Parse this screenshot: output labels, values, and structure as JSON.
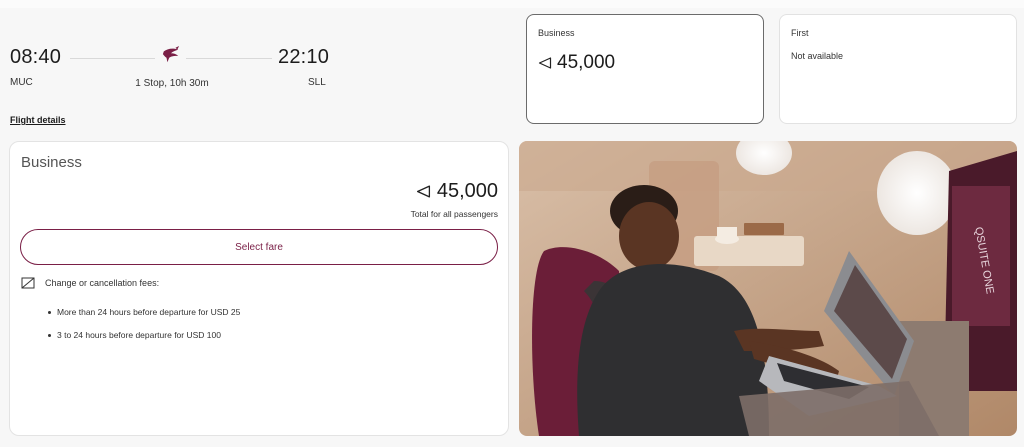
{
  "flight": {
    "depart_time": "08:40",
    "depart_code": "MUC",
    "arrive_time": "22:10",
    "arrive_code": "SLL",
    "stops": "1 Stop, 10h 30m",
    "details_link": "Flight details"
  },
  "cabins": [
    {
      "name": "Business",
      "price": "45,000",
      "selected": true
    },
    {
      "name": "First",
      "status": "Not available"
    }
  ],
  "fare": {
    "title": "Business",
    "price": "45,000",
    "note": "Total for all passengers",
    "select_label": "Select fare",
    "fees_label": "Change or cancellation fees:",
    "fees": [
      "More than 24 hours before departure for USD 25",
      "3 to 24 hours before departure for USD 100"
    ]
  },
  "image": {
    "screen_text": "QSUITE ONE"
  },
  "colors": {
    "brand": "#7a1f46",
    "card_border_selected": "#6b6b6b",
    "background": "#f7f7f7"
  },
  "icons": {
    "airline_logo": "oryx-logo-icon",
    "avios": "avios-icon",
    "no_change": "no-change-icon"
  }
}
